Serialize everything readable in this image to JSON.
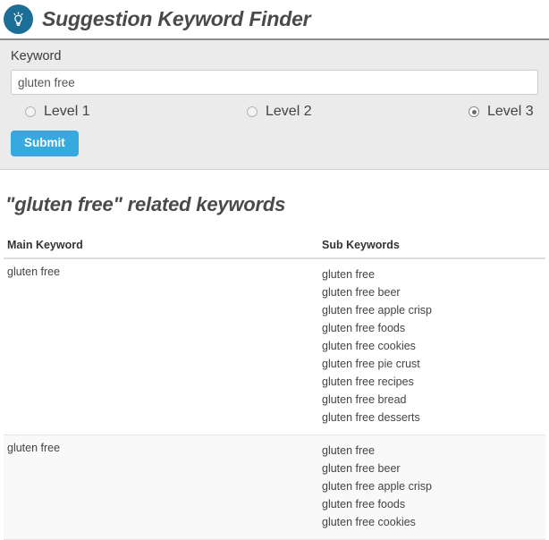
{
  "header": {
    "title": "Suggestion Keyword Finder",
    "logo_icon": "lightbulb-icon"
  },
  "form": {
    "keyword_label": "Keyword",
    "keyword_value": "gluten free",
    "keyword_placeholder": "",
    "levels": [
      {
        "label": "Level 1",
        "checked": false
      },
      {
        "label": "Level 2",
        "checked": false
      },
      {
        "label": "Level 3",
        "checked": true
      }
    ],
    "submit_label": "Submit"
  },
  "results": {
    "title": "\"gluten free\" related keywords",
    "columns": {
      "main": "Main Keyword",
      "sub": "Sub Keywords"
    },
    "rows": [
      {
        "main": "gluten free",
        "subs": [
          "gluten free",
          "gluten free beer",
          "gluten free apple crisp",
          "gluten free foods",
          "gluten free cookies",
          "gluten free pie crust",
          "gluten free recipes",
          "gluten free bread",
          "gluten free desserts"
        ]
      },
      {
        "main": "gluten free",
        "subs": [
          "gluten free",
          "gluten free beer",
          "gluten free apple crisp",
          "gluten free foods",
          "gluten free cookies"
        ]
      }
    ]
  },
  "colors": {
    "logo_background": "#1b6e96",
    "submit_background": "#35a9e0",
    "panel_background": "#ebebeb",
    "heading_text": "#4a4a4a"
  }
}
